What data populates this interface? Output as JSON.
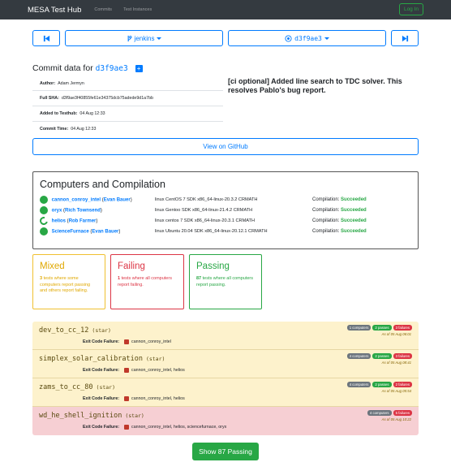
{
  "navbar": {
    "brand": "MESA Test Hub",
    "links": [
      "Commits",
      "Test Instances"
    ],
    "login_label": "Log In"
  },
  "selectors": {
    "branch_label": "jenkins",
    "commit_label": "d3f9ae3",
    "prev_icon": "step-backward-icon",
    "next_icon": "step-forward-icon"
  },
  "commit": {
    "title_prefix": "Commit data for",
    "sha_short": "d3f9ae3",
    "fields": [
      {
        "label": "Author:",
        "value": "Adam Jermyn"
      },
      {
        "label": "Full SHA:",
        "value": "d3f9ae3f40855fe61e34375dcb75adede9d1a7bb"
      },
      {
        "label": "Added to Testhub:",
        "value": "04 Aug 12:33"
      },
      {
        "label": "Commit Time:",
        "value": "04 Aug 12:33"
      }
    ],
    "message": "[ci optional] Added line search to TDC solver. This resolves Pablo's bug report.",
    "github_label": "View on GitHub"
  },
  "computers": {
    "heading": "Computers and Compilation",
    "rows": [
      {
        "computer": "cannon_conroy_intel",
        "user": "Evan Bauer",
        "sdk": "linux CentOS 7 SDK x86_64-linux-20.3.2 CRMATH",
        "compilation_label": "Compilation:",
        "compilation": "Succeeded",
        "state": "done"
      },
      {
        "computer": "oryx",
        "user": "Rich Townsend",
        "sdk": "linux Gentoo SDK x86_64-linux-21.4.2 CRMATH",
        "compilation_label": "Compilation:",
        "compilation": "Succeeded",
        "state": "done"
      },
      {
        "computer": "helios",
        "user": "Rob Farmer",
        "sdk": "linux centos 7 SDK x86_64-linux-20.3.1 CRMATH",
        "compilation_label": "Compilation:",
        "compilation": "Succeeded",
        "state": "running"
      },
      {
        "computer": "ScienceFurnace",
        "user": "Evan Bauer",
        "sdk": "linux Ubuntu 20.04 SDK x86_64-linux-20.12.1 CRMATH",
        "compilation_label": "Compilation:",
        "compilation": "Succeeded",
        "state": "done"
      }
    ]
  },
  "summary": {
    "mixed": {
      "title": "Mixed",
      "count": "3",
      "text": "tests where some computers report passing and others report failing."
    },
    "failing": {
      "title": "Failing",
      "count": "1",
      "text": "tests where all computers report failing."
    },
    "passing": {
      "title": "Passing",
      "count": "87",
      "text": "tests where all computers report passing."
    }
  },
  "tests": [
    {
      "name": "dev_to_cc_12",
      "platform": "(star)",
      "badge_computers": "1 computers",
      "badge_passes": "2 passes",
      "badge_failures": "3 failures",
      "asof": "As of 05 Aug 06:01",
      "exit_label": "Exit Code Failure:",
      "exit_computers": "cannon_conroy_intel",
      "status": "warn"
    },
    {
      "name": "simplex_solar_calibration",
      "platform": "(star)",
      "badge_computers": "4 computers",
      "badge_passes": "2 passes",
      "badge_failures": "3 failures",
      "asof": "As of 05 Aug 08:41",
      "exit_label": "Exit Code Failure:",
      "exit_computers": "cannon_conroy_intel, helios",
      "status": "warn"
    },
    {
      "name": "zams_to_cc_80",
      "platform": "(star)",
      "badge_computers": "4 computers",
      "badge_passes": "2 passes",
      "badge_failures": "2 failures",
      "asof": "As of 05 Aug 05:54",
      "exit_label": "Exit Code Failure:",
      "exit_computers": "cannon_conroy_intel, helios",
      "status": "warn"
    },
    {
      "name": "wd_he_shell_ignition",
      "platform": "(star)",
      "badge_computers": "4 computers",
      "badge_passes": "",
      "badge_failures": "5 failures",
      "asof": "As of 05 Aug 10:22",
      "exit_label": "Exit Code Failure:",
      "exit_computers": "cannon_conroy_intel, helios, sciencefurnace, oryx",
      "status": "danger"
    }
  ],
  "show_passing_label": "Show 87 Passing"
}
